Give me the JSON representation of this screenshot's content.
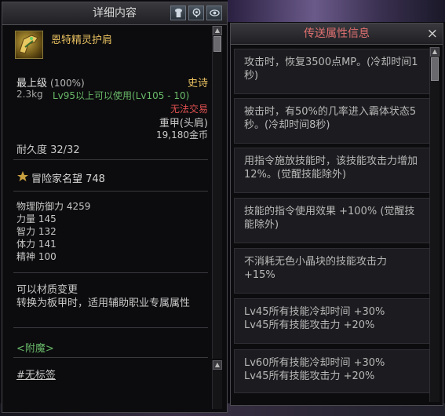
{
  "left": {
    "title": "详细内容",
    "item_name": "恩特精灵护肩",
    "grade": "最上级",
    "grade_pct": "(100%)",
    "rarity": "史诗",
    "weight": "2.3kg",
    "level_req": "Lv95以上可以使用(Lv105 - 10)",
    "trade": "无法交易",
    "armor_type": "重甲(头肩)",
    "price": "19,180金币",
    "durability": "耐久度 32/32",
    "renown": "冒险家名望 748",
    "stats": [
      "物理防御力 4259",
      "力量 145",
      "智力 132",
      "体力 141",
      "精神 100"
    ],
    "desc_line1": "可以材质变更",
    "desc_line2": "转换为板甲时，适用辅助职业专属属性",
    "enchant": "<附魔>",
    "tag": "#无标签"
  },
  "right": {
    "title": "传送属性信息",
    "close": "×",
    "entries": [
      "攻击时，恢复3500点MP。(冷却时间1秒)",
      "被击时，有50%的几率进入霸体状态5秒。(冷却时间8秒)",
      "用指令施放技能时，该技能攻击力增加12%。(觉醒技能除外)",
      "技能的指令使用效果 +100% (觉醒技能除外)",
      "不消耗无色小晶块的技能攻击力 +15%",
      "Lv45所有技能冷却时间 +30%\nLv45所有技能攻击力 +20%",
      "Lv60所有技能冷却时间 +30%\nLv45所有技能攻击力 +20%"
    ]
  },
  "colors": {
    "item_name": "#e8c060",
    "epic": "#e8c060",
    "green": "#68b868",
    "red": "#e05050",
    "right_title": "#e07070"
  },
  "icons": [
    "equip-compare-icon",
    "location-pin-icon",
    "eye-icon",
    "close-icon",
    "renown-icon",
    "shoulder-armor-icon"
  ]
}
